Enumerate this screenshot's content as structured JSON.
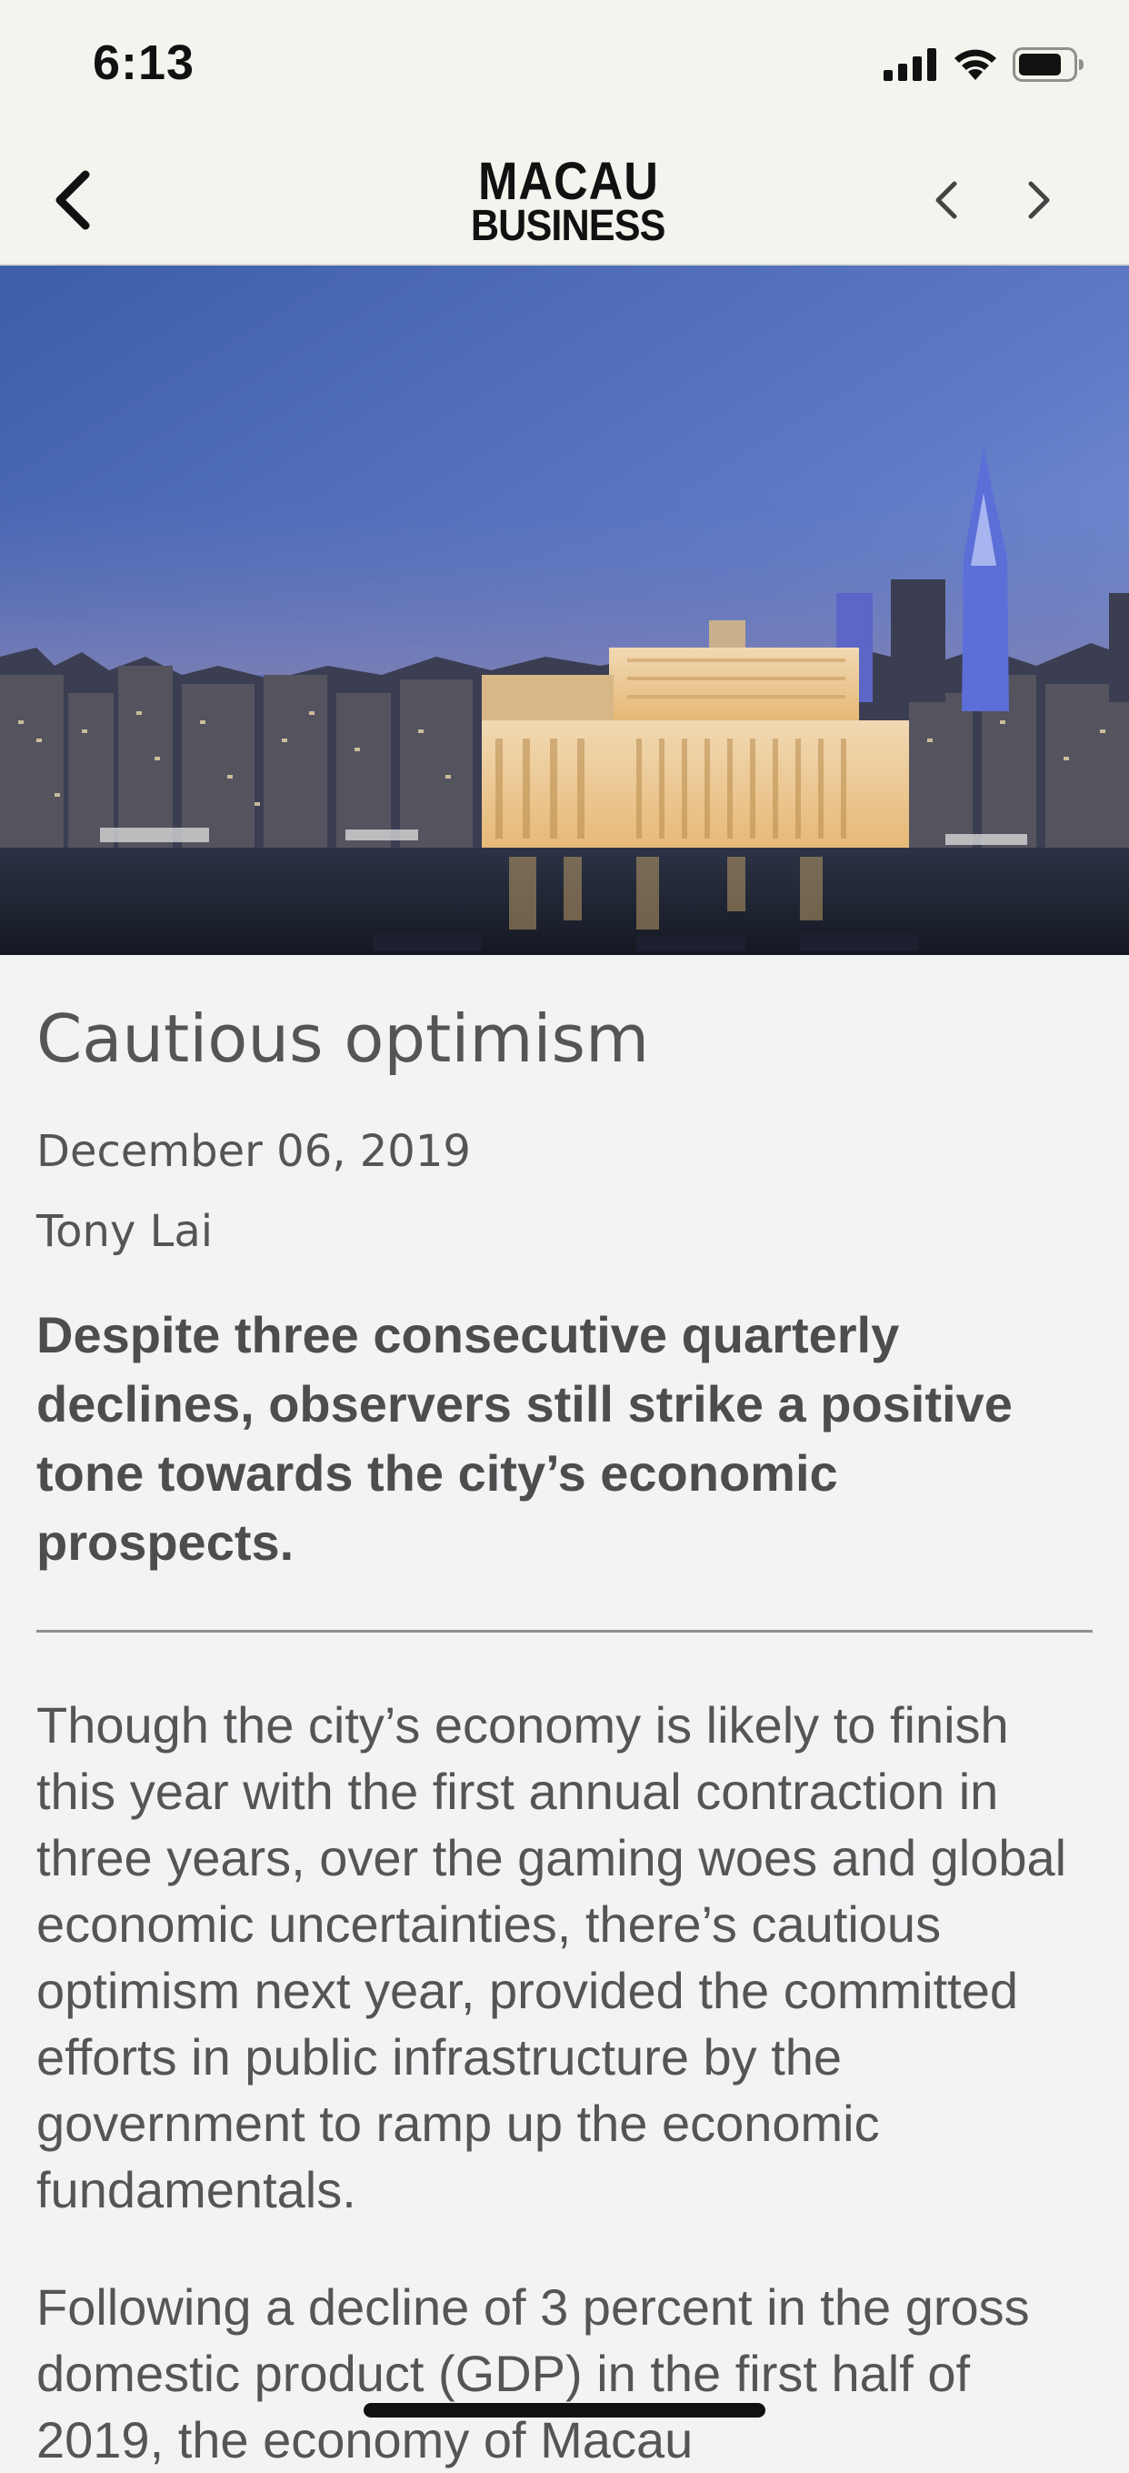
{
  "status_bar": {
    "time": "6:13"
  },
  "nav": {
    "logo_line1": "MACAU",
    "logo_line2": "BUSINESS",
    "back_icon": "chevron-left-icon",
    "prev_icon": "chevron-left-icon",
    "next_icon": "chevron-right-icon"
  },
  "article": {
    "title": "Cautious optimism",
    "date": "December 06, 2019",
    "author": "Tony Lai",
    "lead": "Despite three consecutive quarterly declines, observers still strike a positive tone towards the city’s economic prospects.",
    "paragraphs": [
      "Though the city’s economy is likely to finish this year with the first annual contraction in three years, over the gaming woes and global economic uncertainties, there’s cautious optimism next year, provided the committed efforts in public infrastructure by the government to ramp up the economic fundamentals.",
      "Following a decline of 3 percent in the gross domestic product (GDP) in the first half of 2019, the economy of Macau"
    ]
  },
  "colors": {
    "bar_background": "#f4f4ef",
    "page_background": "#f2f3f5",
    "text": "#555555"
  }
}
